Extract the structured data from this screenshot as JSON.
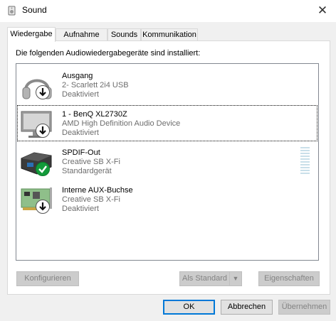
{
  "window": {
    "title": "Sound",
    "close_glyph": "✕",
    "icon": "speaker-icon"
  },
  "tabs": [
    {
      "label": "Wiedergabe",
      "active": true
    },
    {
      "label": "Aufnahme",
      "active": false
    },
    {
      "label": "Sounds",
      "active": false
    },
    {
      "label": "Kommunikation",
      "active": false
    }
  ],
  "intro": "Die folgenden Audiowiedergabegeräte sind installiert:",
  "devices": [
    {
      "name": "Ausgang",
      "sub": "2- Scarlett 2i4 USB",
      "state": "Deaktiviert",
      "icon": "headphones-icon",
      "badge": "disabled-arrow-icon"
    },
    {
      "name": "1 - BenQ XL2730Z",
      "sub": "AMD High Definition Audio Device",
      "state": "Deaktiviert",
      "icon": "monitor-icon",
      "badge": "disabled-arrow-icon",
      "focused": true
    },
    {
      "name": "SPDIF-Out",
      "sub": "Creative SB X-Fi",
      "state": "Standardgerät",
      "icon": "digital-output-icon",
      "badge": "default-check-icon"
    },
    {
      "name": "Interne AUX-Buchse",
      "sub": "Creative SB X-Fi",
      "state": "Deaktiviert",
      "icon": "sound-card-icon",
      "badge": "disabled-arrow-icon"
    }
  ],
  "panel_buttons": {
    "configure": "Konfigurieren",
    "set_default": "Als Standard",
    "properties": "Eigenschaften"
  },
  "dialog_buttons": {
    "ok": "OK",
    "cancel": "Abbrechen",
    "apply": "Übernehmen"
  },
  "colors": {
    "accent": "#0078d7",
    "default_badge": "#139b3a",
    "meter": "#c9dfe9"
  }
}
